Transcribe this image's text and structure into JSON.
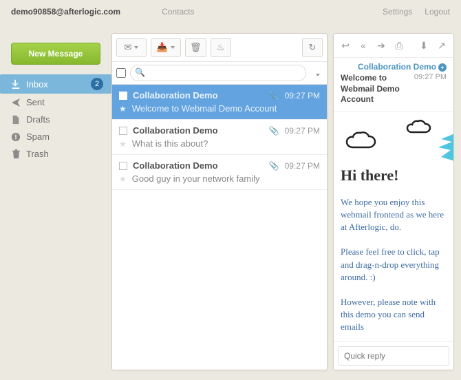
{
  "topbar": {
    "email": "demo90858@afterlogic.com",
    "contacts": "Contacts",
    "settings": "Settings",
    "logout": "Logout"
  },
  "compose": {
    "label": "New Message"
  },
  "folders": [
    {
      "icon": "download",
      "label": "Inbox",
      "active": true,
      "count": 2
    },
    {
      "icon": "send",
      "label": "Sent"
    },
    {
      "icon": "file",
      "label": "Drafts"
    },
    {
      "icon": "exclaim",
      "label": "Spam"
    },
    {
      "icon": "trash",
      "label": "Trash"
    }
  ],
  "search_placeholder": "",
  "messages": [
    {
      "from": "Collaboration Demo",
      "subject": "Welcome to Webmail Demo Account",
      "time": "09:27 PM",
      "attachment": true,
      "selected": true,
      "unread": true
    },
    {
      "from": "Collaboration Demo",
      "subject": "What is this about?",
      "time": "09:27 PM",
      "attachment": true,
      "selected": false,
      "unread": true
    },
    {
      "from": "Collaboration Demo",
      "subject": "Good guy in your network family",
      "time": "09:27 PM",
      "attachment": true,
      "selected": false,
      "unread": true
    }
  ],
  "reader": {
    "from": "Collaboration Demo",
    "subject": "Welcome to Webmail Demo Account",
    "time": "09:27 PM",
    "title": "Hi there!",
    "para1": "We hope you enjoy this webmail frontend as we here at Afterlogic, do.",
    "para2": "Please feel free to click, tap and drag-n-drop everything around. :)",
    "para3": "However, please note with this demo you can send emails",
    "quick_placeholder": "Quick reply"
  }
}
